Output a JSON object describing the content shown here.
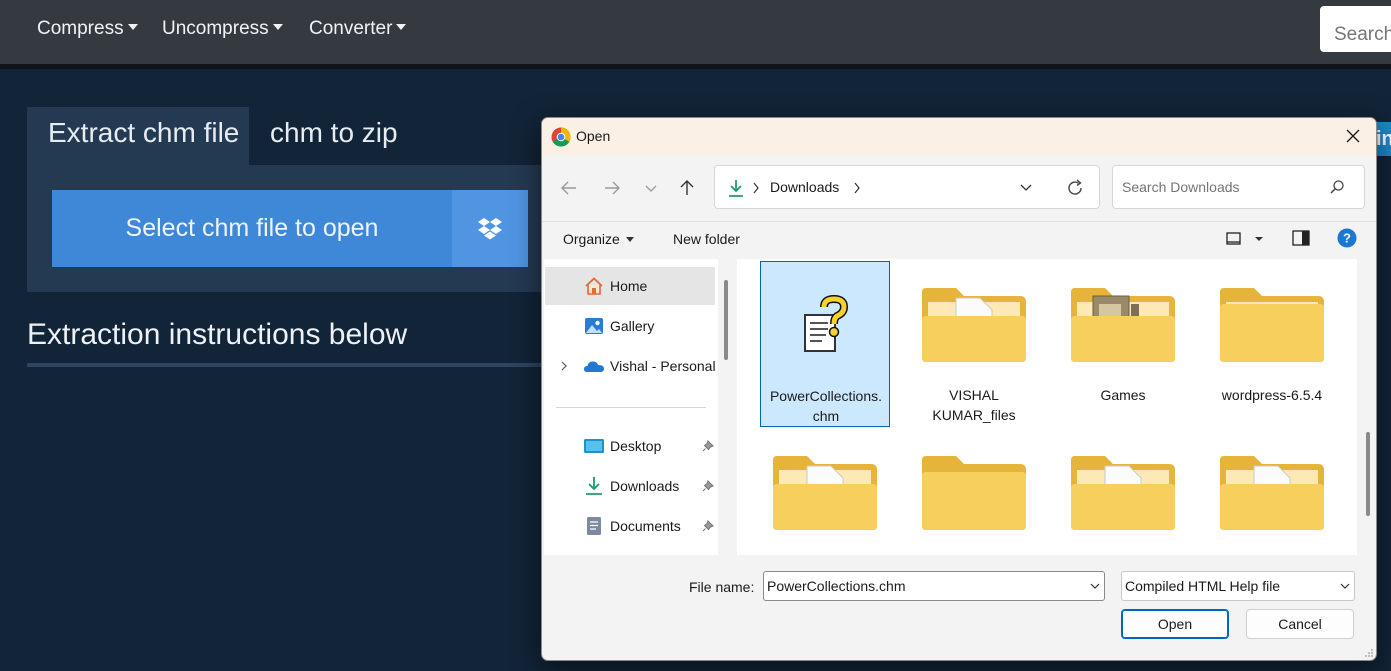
{
  "nav": {
    "items": [
      {
        "label": "Compress"
      },
      {
        "label": "Uncompress"
      },
      {
        "label": "Converter"
      }
    ],
    "search_placeholder": "Search"
  },
  "page": {
    "tabs": [
      {
        "label": "Extract chm file"
      },
      {
        "label": "chm to zip"
      }
    ],
    "select_button": "Select chm file to open",
    "instructions_heading": "Extraction instructions below",
    "right_peek": "in"
  },
  "dialog": {
    "title": "Open",
    "address": {
      "location": "Downloads"
    },
    "search_placeholder": "Search Downloads",
    "commands": {
      "organize": "Organize",
      "new_folder": "New folder"
    },
    "nav_items": [
      {
        "label": "Home",
        "icon": "home-icon"
      },
      {
        "label": "Gallery",
        "icon": "gallery-icon"
      },
      {
        "label": "Vishal - Personal",
        "icon": "onedrive-cloud-icon"
      },
      {
        "label": "Desktop",
        "icon": "desktop-icon"
      },
      {
        "label": "Downloads",
        "icon": "download-arrow-icon"
      },
      {
        "label": "Documents",
        "icon": "document-icon"
      }
    ],
    "files": [
      {
        "name": "PowerCollections.\nchm",
        "type": "chm-file-icon",
        "selected": true
      },
      {
        "name": "VISHAL KUMAR_files",
        "type": "folder-icon"
      },
      {
        "name": "Games",
        "type": "folder-icon"
      },
      {
        "name": "wordpress-6.5.4",
        "type": "folder-icon"
      },
      {
        "name": "",
        "type": "folder-icon"
      },
      {
        "name": "",
        "type": "folder-icon"
      },
      {
        "name": "",
        "type": "folder-icon"
      },
      {
        "name": "",
        "type": "folder-icon"
      }
    ],
    "file_name_label": "File name:",
    "file_name_value": "PowerCollections.chm",
    "file_type_value": "Compiled HTML Help file",
    "open_label": "Open",
    "cancel_label": "Cancel"
  },
  "colors": {
    "page_bg": "#122438",
    "navbar_bg": "#343a40",
    "panel_bg": "#243a52",
    "select_button_bg": "#3f88d8",
    "dialog_accent": "#0067c0",
    "selected_item_bg": "#cce8ff",
    "folder_yellow": "#f5c74e"
  }
}
